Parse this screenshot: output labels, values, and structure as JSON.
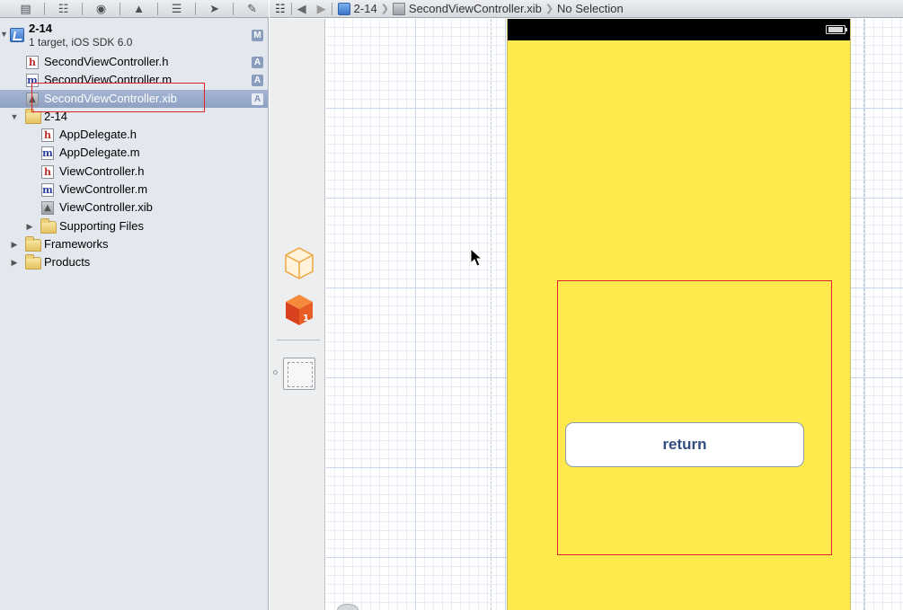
{
  "navigator_toolbar": {
    "icons": [
      "folder-icon",
      "hierarchy-icon",
      "search-icon",
      "warning-icon",
      "list-icon",
      "breakpoint-icon",
      "log-icon"
    ]
  },
  "project": {
    "name": "2-14",
    "subtitle": "1 target, iOS SDK 6.0",
    "badge": "M"
  },
  "files": {
    "root": [
      {
        "name": "SecondViewController.h",
        "type": "h",
        "badge": "A"
      },
      {
        "name": "SecondViewController.m",
        "type": "m",
        "badge": "A"
      },
      {
        "name": "SecondViewController.xib",
        "type": "xib",
        "badge": "A"
      }
    ],
    "group_name": "2-14",
    "group": [
      {
        "name": "AppDelegate.h",
        "type": "h"
      },
      {
        "name": "AppDelegate.m",
        "type": "m"
      },
      {
        "name": "ViewController.h",
        "type": "h"
      },
      {
        "name": "ViewController.m",
        "type": "m"
      },
      {
        "name": "ViewController.xib",
        "type": "xib"
      }
    ],
    "supporting_files": "Supporting Files",
    "frameworks": "Frameworks",
    "products": "Products"
  },
  "jump_bar": {
    "project": "2-14",
    "file": "SecondViewController.xib",
    "selection": "No Selection"
  },
  "device": {
    "background_color": "#ffe94c",
    "button_label": "return"
  },
  "colors": {
    "selection": "#8ea1c3",
    "annotation": "#e0232a"
  }
}
